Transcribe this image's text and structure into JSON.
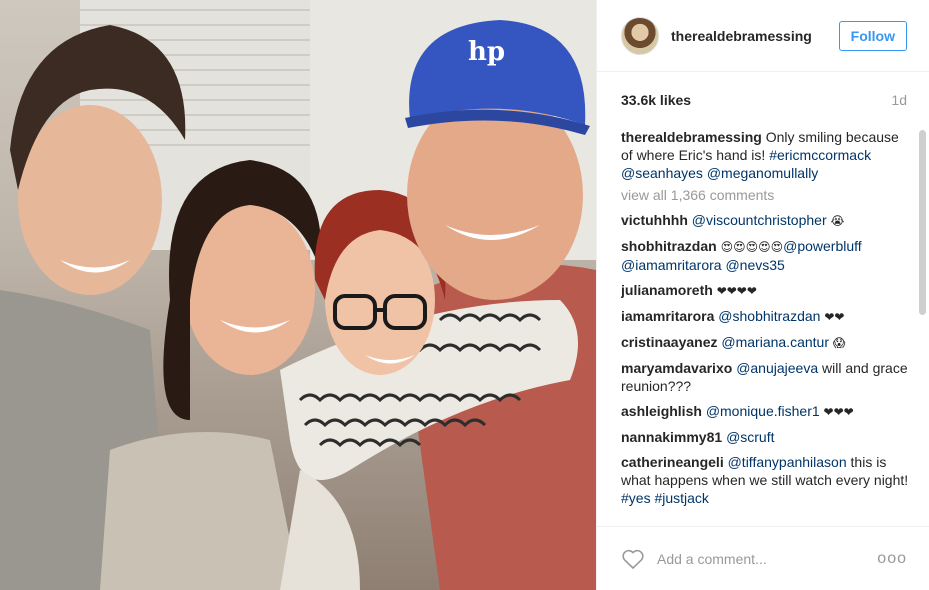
{
  "post": {
    "username": "therealdebramessing",
    "follow_label": "Follow",
    "likes": "33.6k likes",
    "age": "1d",
    "caption": {
      "user": "therealdebramessing",
      "text": "Only smiling because of where Eric's hand is!",
      "tags": [
        "#ericmccormack",
        "@seanhayes",
        "@meganomullally"
      ]
    },
    "view_all": "view all 1,366 comments",
    "comments": [
      {
        "user": "victuhhhh",
        "mention": "@viscountchristopher",
        "text": "",
        "emoji": "😭"
      },
      {
        "user": "shobhitrazdan",
        "pre_emoji": "😍😍😍😍😍",
        "mention": "@powerbluff",
        "text": "@iamamritarora @nevs35"
      },
      {
        "user": "julianamoreth",
        "text": "",
        "emoji": "❤❤❤❤"
      },
      {
        "user": "iamamritarora",
        "mention": "@shobhitrazdan",
        "text": "",
        "emoji": "❤❤"
      },
      {
        "user": "cristinaayanez",
        "mention": "@mariana.cantur",
        "text": "",
        "emoji": "😱"
      },
      {
        "user": "maryamdavarixo",
        "mention": "@anujajeeva",
        "text": "will and grace reunion???"
      },
      {
        "user": "ashleighlish",
        "mention": "@monique.fisher1",
        "text": "",
        "emoji": "❤❤❤"
      },
      {
        "user": "nannakimmy81",
        "mention": "@scruft",
        "text": ""
      },
      {
        "user": "catherineangeli",
        "mention": "@tiffanypanhilason",
        "text": "this is what happens when we still watch every night!",
        "tags": "#yes #justjack"
      }
    ],
    "comment_placeholder": "Add a comment...",
    "more_label": "ooo"
  },
  "photo": {
    "cap_text": "hp",
    "cap_color": "#3a5bb8"
  }
}
